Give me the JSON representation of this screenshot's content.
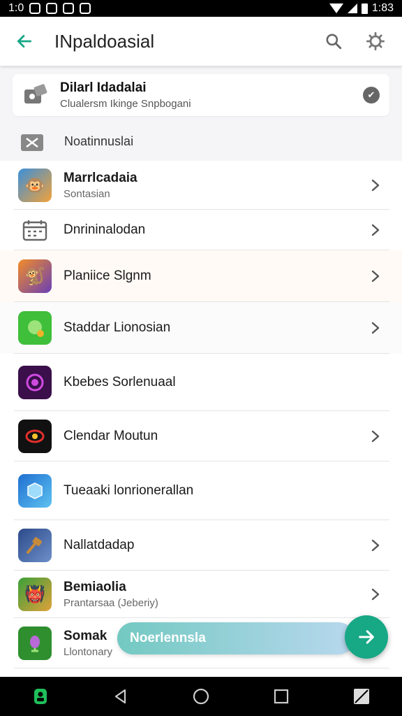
{
  "status": {
    "time_left": "1:0",
    "time": "1:83"
  },
  "app_bar": {
    "title": "INpaldoasial"
  },
  "top_card": {
    "title": "Dilarl Idadalai",
    "subtitle": "Clualersm Ikinge Snpbogani"
  },
  "section": {
    "label": "Noatinnuslai"
  },
  "items": [
    {
      "title": "Marrlcadaia",
      "subtitle": "Sontasian",
      "icon": "monkey-app-icon",
      "chevron": true
    },
    {
      "title": "Dnrininalodan",
      "subtitle": "",
      "icon": "calendar-icon",
      "chevron": true
    },
    {
      "title": "Planiice Slgnm",
      "subtitle": "",
      "icon": "game-app-icon",
      "chevron": true
    },
    {
      "title": "Staddar Lionosian",
      "subtitle": "",
      "icon": "green-app-icon",
      "chevron": true
    },
    {
      "title": "Kbebes Sorlenuaal",
      "subtitle": "",
      "icon": "purple-app-icon",
      "chevron": false
    },
    {
      "title": "Clendar Moutun",
      "subtitle": "",
      "icon": "dark-app-icon",
      "chevron": true
    },
    {
      "title": "Tueaaki lonrionerallan",
      "subtitle": "",
      "icon": "cube-app-icon",
      "chevron": false
    },
    {
      "title": "Nallatdadap",
      "subtitle": "",
      "icon": "hammer-app-icon",
      "chevron": true
    },
    {
      "title": "Bemiaolia",
      "subtitle": "Prantarsaa (Jeberiy)",
      "icon": "monster-app-icon",
      "chevron": true
    },
    {
      "title": "Somak",
      "subtitle": "Llontonary",
      "icon": "plant-app-icon",
      "chevron": false
    }
  ],
  "fab_pill": {
    "label": "Noerlennsla"
  },
  "colors": {
    "accent": "#17a886",
    "pill_start": "#73c9c2",
    "pill_end": "#b8d8ee"
  }
}
